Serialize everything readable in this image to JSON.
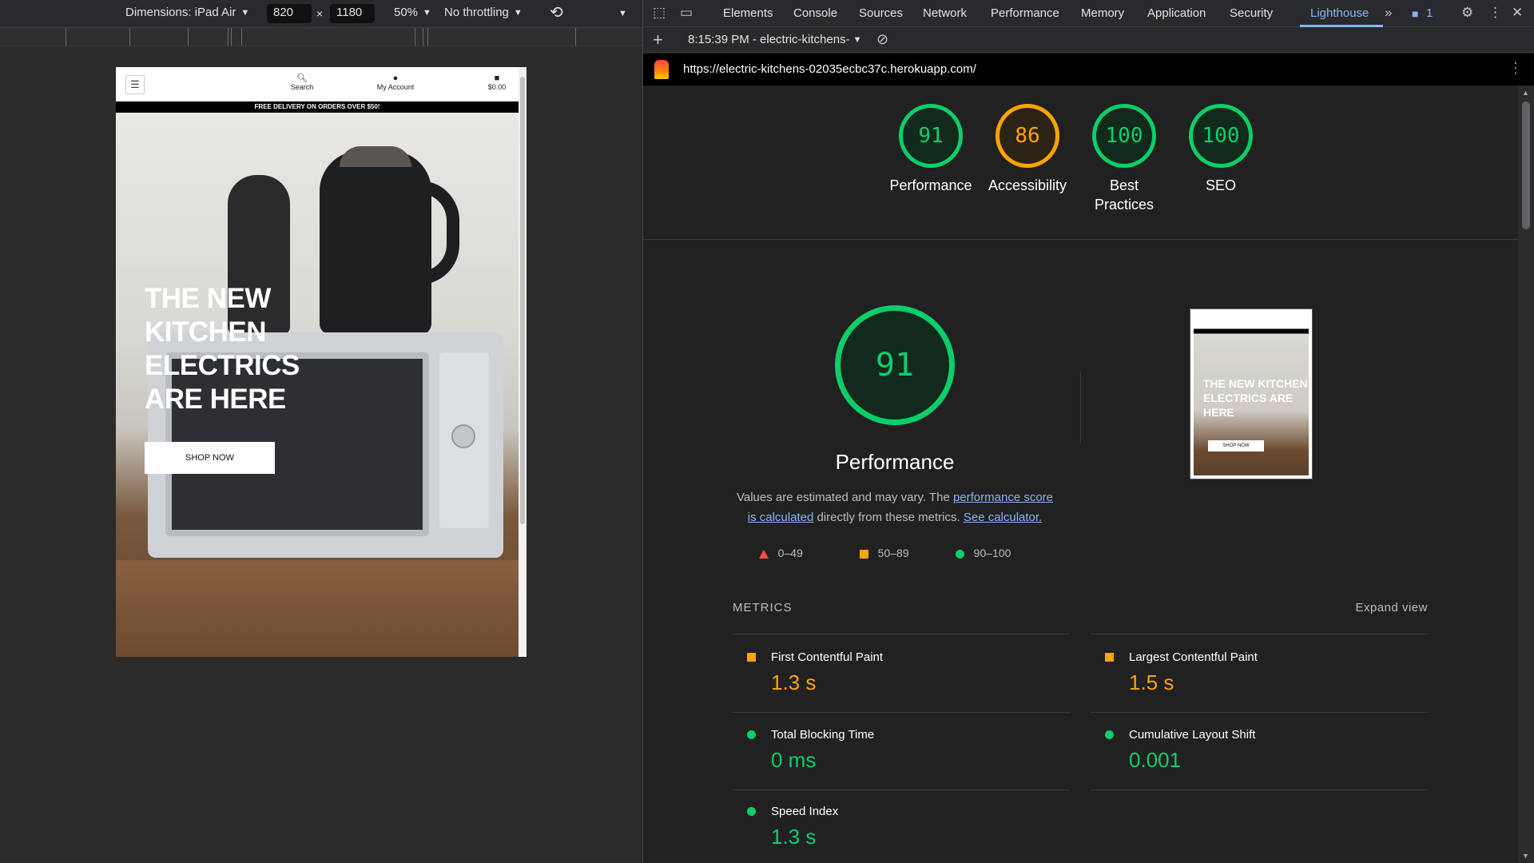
{
  "device_toolbar": {
    "dimensions_label": "Dimensions: iPad Air",
    "width": "820",
    "height": "1180",
    "times": "×",
    "zoom": "50%",
    "throttling": "No throttling"
  },
  "site": {
    "nav": {
      "search": "Search",
      "account": "My Account",
      "cart": "$0.00"
    },
    "promo": "FREE DELIVERY ON ORDERS OVER $50!",
    "hero_title": "THE NEW KITCHEN ELECTRICS ARE HERE",
    "hero_cta": "SHOP NOW"
  },
  "devtools": {
    "tabs": [
      "Elements",
      "Console",
      "Sources",
      "Network",
      "Performance",
      "Memory",
      "Application",
      "Security",
      "Lighthouse"
    ],
    "active_tab": "Lighthouse",
    "issues_count": "1",
    "report_selector": "8:15:39 PM - electric-kitchens-",
    "url": "https://electric-kitchens-02035ecbc37c.herokuapp.com/"
  },
  "scores": [
    {
      "label": "Performance",
      "value": "91",
      "status": "pass"
    },
    {
      "label": "Accessibility",
      "value": "86",
      "status": "average"
    },
    {
      "label": "Best Practices",
      "value": "100",
      "status": "pass"
    },
    {
      "label": "SEO",
      "value": "100",
      "status": "pass"
    }
  ],
  "performance": {
    "score": "91",
    "title": "Performance",
    "note_prefix": "Values are estimated and may vary. The ",
    "note_link1": "performance score is calculated",
    "note_middle": " directly from these metrics. ",
    "note_link2": "See calculator.",
    "legend": {
      "fail": "0–49",
      "average": "50–89",
      "pass": "90–100"
    }
  },
  "thumbnail": {
    "title": "THE NEW KITCHEN ELECTRICS ARE HERE",
    "cta": "SHOP NOW"
  },
  "metrics": {
    "heading": "METRICS",
    "expand": "Expand view",
    "items": [
      {
        "name": "First Contentful Paint",
        "value": "1.3 s",
        "status": "average"
      },
      {
        "name": "Largest Contentful Paint",
        "value": "1.5 s",
        "status": "average"
      },
      {
        "name": "Total Blocking Time",
        "value": "0 ms",
        "status": "pass"
      },
      {
        "name": "Cumulative Layout Shift",
        "value": "0.001",
        "status": "pass"
      },
      {
        "name": "Speed Index",
        "value": "1.3 s",
        "status": "pass"
      }
    ]
  },
  "colors": {
    "pass": "#0cce6b",
    "average": "#ffa400",
    "fail": "#ff4e42",
    "link": "#8ab4f8"
  }
}
